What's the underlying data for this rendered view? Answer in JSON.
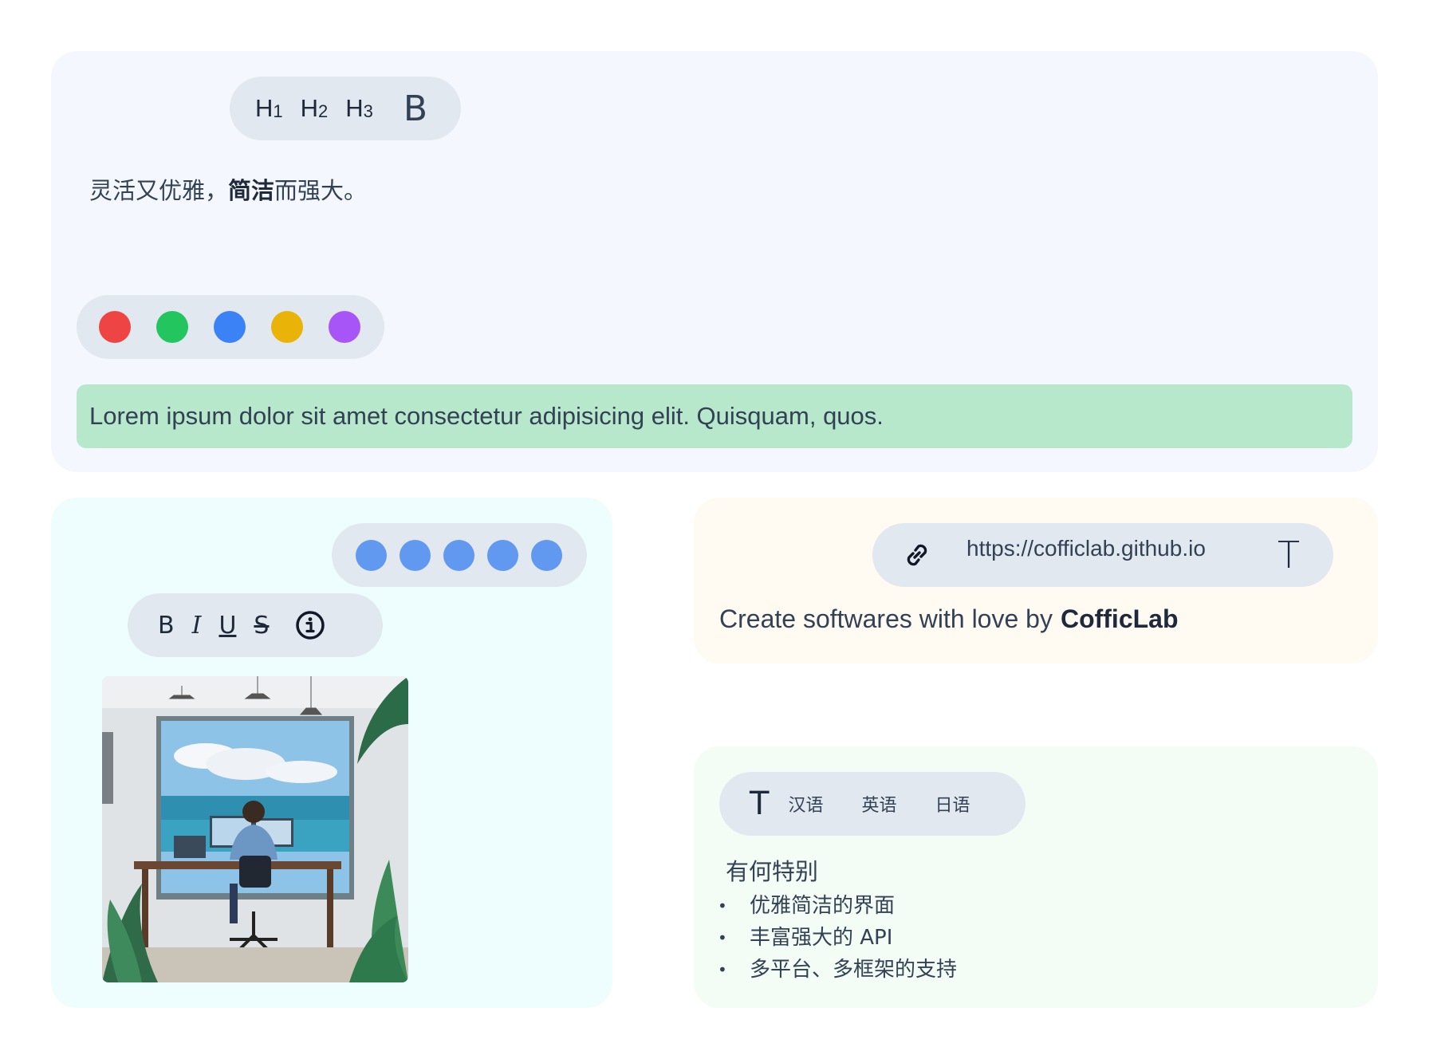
{
  "heading_toolbar": {
    "h1": {
      "letter": "H",
      "num": "1"
    },
    "h2": {
      "letter": "H",
      "num": "2"
    },
    "h3": {
      "letter": "H",
      "num": "3"
    },
    "bold": "B"
  },
  "intro": {
    "part1": "灵活又优雅，",
    "bold": "简洁",
    "part2": "而强大。"
  },
  "colors": [
    "#ef4444",
    "#22c55e",
    "#3b82f6",
    "#eab308",
    "#a855f7"
  ],
  "highlight_text": "Lorem ipsum dolor sit amet consectetur adipisicing elit. Quisquam, quos.",
  "highlight_color": "#b7e8cb",
  "blue_dots_color": "#6198f0",
  "format_toolbar": {
    "bold": "B",
    "italic": "I",
    "underline": "U",
    "strike": "S",
    "info_icon": "info-circle-icon"
  },
  "link_toolbar": {
    "link_icon": "link-icon",
    "url": "https://cofficlab.github.io",
    "text_button": "T"
  },
  "credit": {
    "prefix": "Create softwares with love by",
    "brand": "CofficLab"
  },
  "lang_toolbar": {
    "t_button": "T",
    "chinese": "汉语",
    "english": "英语",
    "japanese": "日语"
  },
  "features": {
    "title": "有何特别",
    "items": [
      "优雅简洁的界面",
      "丰富强大的 API",
      "多平台、多框架的支持"
    ]
  },
  "image": {
    "alt_icon": "office-illustration"
  }
}
